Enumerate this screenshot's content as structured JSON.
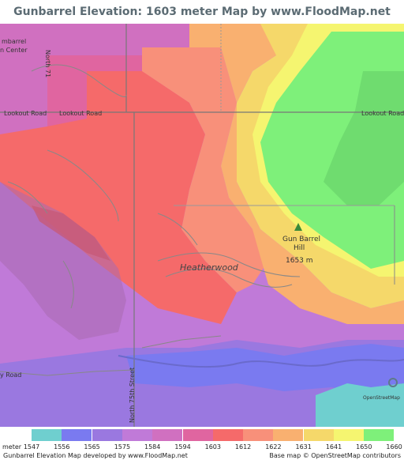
{
  "title": "Gunbarrel Elevation: 1603 meter Map by www.FloodMap.net (beta)",
  "map": {
    "place_labels": {
      "gunbarrel_center": "mbarrel\nn Center",
      "heatherwood": "Heatherwood",
      "peak_name": "Gun Barrel",
      "peak_name_line2": "Hill",
      "peak_elev": "1653 m"
    },
    "road_labels": {
      "lookout_road_1": "Lookout Road",
      "lookout_road_2": "Lookout Road",
      "lookout_road_3": "Lookout Road",
      "north_71": "North 71",
      "north_75th": "North 75th Street",
      "y_road": "y Road"
    },
    "colors": {
      "c1547": "#6fcfcf",
      "c1556": "#7a7af0",
      "c1565": "#9a78e0",
      "c1575": "#c07ad8",
      "c1584": "#d070c0",
      "c1594": "#e065a0",
      "c1603": "#f56a6a",
      "c1612": "#f8907a",
      "c1622": "#f9b070",
      "c1631": "#f5d86a",
      "c1641": "#f5f570",
      "c1650": "#7ef07a",
      "c1660": "#6fdc6f"
    },
    "osm_logo_text": "OpenStreetMap"
  },
  "legend": {
    "unit": "meter",
    "values": [
      "1547",
      "1556",
      "1565",
      "1575",
      "1584",
      "1594",
      "1603",
      "1612",
      "1622",
      "1631",
      "1641",
      "1650",
      "1660"
    ],
    "colors": [
      "#6fcfcf",
      "#7a7af0",
      "#9a78e0",
      "#c07ad8",
      "#d070c0",
      "#e065a0",
      "#f56a6a",
      "#f8907a",
      "#f9b070",
      "#f5d86a",
      "#f5f570",
      "#7ef07a",
      "#6fdc6f"
    ],
    "footer_left": "Gunbarrel Elevation Map developed by www.FloodMap.net",
    "footer_right": "Base map © OpenStreetMap contributors"
  }
}
